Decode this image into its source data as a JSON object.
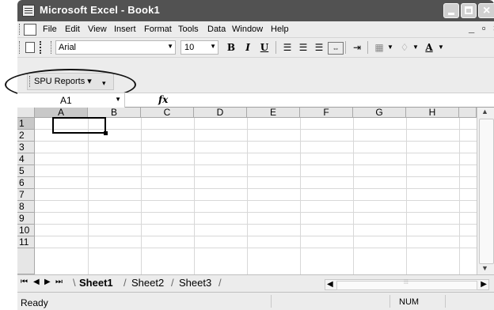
{
  "window": {
    "title": "Microsoft Excel - Book1",
    "close_glyph": "×"
  },
  "menu": {
    "items": [
      {
        "label": "File"
      },
      {
        "label": "Edit"
      },
      {
        "label": "View"
      },
      {
        "label": "Insert"
      },
      {
        "label": "Format"
      },
      {
        "label": "Tools"
      },
      {
        "label": "Data"
      },
      {
        "label": "Window"
      },
      {
        "label": "Help"
      }
    ],
    "right_controls": "_ ▫ ×"
  },
  "toolbar": {
    "font_name": "Arial",
    "font_size": "10",
    "bold_label": "B",
    "italic_label": "I",
    "underline_label": "U",
    "font_color_label": "A"
  },
  "custom_toolbar": {
    "spu_reports_label": "SPU Reports ▾"
  },
  "formula_bar": {
    "name_box": "A1",
    "fx_label": "fx"
  },
  "grid": {
    "columns": [
      "A",
      "B",
      "C",
      "D",
      "E",
      "F",
      "G",
      "H"
    ],
    "rows": [
      "1",
      "2",
      "3",
      "4",
      "5",
      "6",
      "7",
      "8",
      "9",
      "10",
      "11"
    ],
    "active_cell": "A1"
  },
  "sheets": {
    "tabs": [
      "Sheet1",
      "Sheet2",
      "Sheet3"
    ],
    "active": "Sheet1"
  },
  "status": {
    "text": "Ready",
    "num_indicator": "NUM"
  },
  "colors": {
    "title_bar": "#525252",
    "chrome": "#ececec",
    "header": "#e6e6e6",
    "gridline": "#d8d8d8"
  }
}
